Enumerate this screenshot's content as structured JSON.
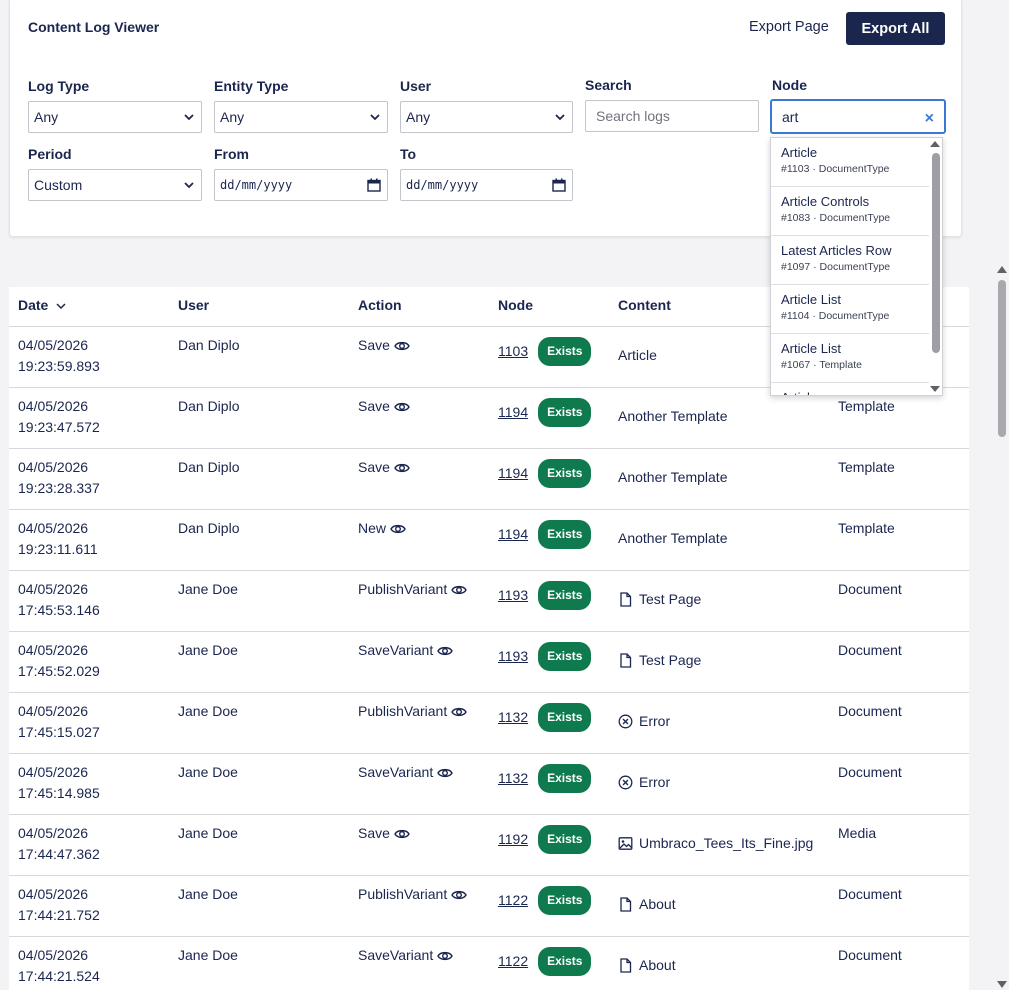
{
  "header": {
    "title": "Content Log Viewer",
    "export_page_label": "Export Page",
    "export_all_label": "Export All"
  },
  "filters": {
    "log_type": {
      "label": "Log Type",
      "value": "Any"
    },
    "entity_type": {
      "label": "Entity Type",
      "value": "Any"
    },
    "user": {
      "label": "User",
      "value": "Any"
    },
    "search": {
      "label": "Search",
      "placeholder": "Search logs"
    },
    "node": {
      "label": "Node",
      "value": "art",
      "clear_icon": "×"
    },
    "period": {
      "label": "Period",
      "value": "Custom"
    },
    "from": {
      "label": "From",
      "value": "dd/mm/yyyy"
    },
    "to": {
      "label": "To",
      "value": "dd/mm/yyyy"
    }
  },
  "node_suggestions": [
    {
      "name": "Article",
      "meta": "#1103 · DocumentType"
    },
    {
      "name": "Article Controls",
      "meta": "#1083 · DocumentType"
    },
    {
      "name": "Latest Articles Row",
      "meta": "#1097 · DocumentType"
    },
    {
      "name": "Article List",
      "meta": "#1104 · DocumentType"
    },
    {
      "name": "Article List",
      "meta": "#1067 · Template"
    },
    {
      "name": "Article",
      "meta": ""
    }
  ],
  "table": {
    "columns": {
      "date": "Date",
      "user": "User",
      "action": "Action",
      "node": "Node",
      "content": "Content"
    },
    "rows": [
      {
        "date": "04/05/2026",
        "time": "19:23:59.893",
        "user": "Dan Diplo",
        "action": "Save",
        "node_id": "1103",
        "status": "Exists",
        "content": "Article",
        "content_icon": "none",
        "type": ""
      },
      {
        "date": "04/05/2026",
        "time": "19:23:47.572",
        "user": "Dan Diplo",
        "action": "Save",
        "node_id": "1194",
        "status": "Exists",
        "content": "Another Template",
        "content_icon": "none",
        "type": "Template"
      },
      {
        "date": "04/05/2026",
        "time": "19:23:28.337",
        "user": "Dan Diplo",
        "action": "Save",
        "node_id": "1194",
        "status": "Exists",
        "content": "Another Template",
        "content_icon": "none",
        "type": "Template"
      },
      {
        "date": "04/05/2026",
        "time": "19:23:11.611",
        "user": "Dan Diplo",
        "action": "New",
        "node_id": "1194",
        "status": "Exists",
        "content": "Another Template",
        "content_icon": "none",
        "type": "Template"
      },
      {
        "date": "04/05/2026",
        "time": "17:45:53.146",
        "user": "Jane Doe",
        "action": "PublishVariant",
        "node_id": "1193",
        "status": "Exists",
        "content": "Test Page",
        "content_icon": "document",
        "type": "Document"
      },
      {
        "date": "04/05/2026",
        "time": "17:45:52.029",
        "user": "Jane Doe",
        "action": "SaveVariant",
        "node_id": "1193",
        "status": "Exists",
        "content": "Test Page",
        "content_icon": "document",
        "type": "Document"
      },
      {
        "date": "04/05/2026",
        "time": "17:45:15.027",
        "user": "Jane Doe",
        "action": "PublishVariant",
        "node_id": "1132",
        "status": "Exists",
        "content": "Error",
        "content_icon": "error",
        "type": "Document"
      },
      {
        "date": "04/05/2026",
        "time": "17:45:14.985",
        "user": "Jane Doe",
        "action": "SaveVariant",
        "node_id": "1132",
        "status": "Exists",
        "content": "Error",
        "content_icon": "error",
        "type": "Document"
      },
      {
        "date": "04/05/2026",
        "time": "17:44:47.362",
        "user": "Jane Doe",
        "action": "Save",
        "node_id": "1192",
        "status": "Exists",
        "content": "Umbraco_Tees_Its_Fine.jpg",
        "content_icon": "image",
        "type": "Media"
      },
      {
        "date": "04/05/2026",
        "time": "17:44:21.752",
        "user": "Jane Doe",
        "action": "PublishVariant",
        "node_id": "1122",
        "status": "Exists",
        "content": "About",
        "content_icon": "document",
        "type": "Document"
      },
      {
        "date": "04/05/2026",
        "time": "17:44:21.524",
        "user": "Jane Doe",
        "action": "SaveVariant",
        "node_id": "1122",
        "status": "Exists",
        "content": "About",
        "content_icon": "document",
        "type": "Document"
      }
    ]
  },
  "colors": {
    "primary": "#1b264f",
    "exists_badge": "#0e7a4d",
    "focus": "#3879d6"
  }
}
